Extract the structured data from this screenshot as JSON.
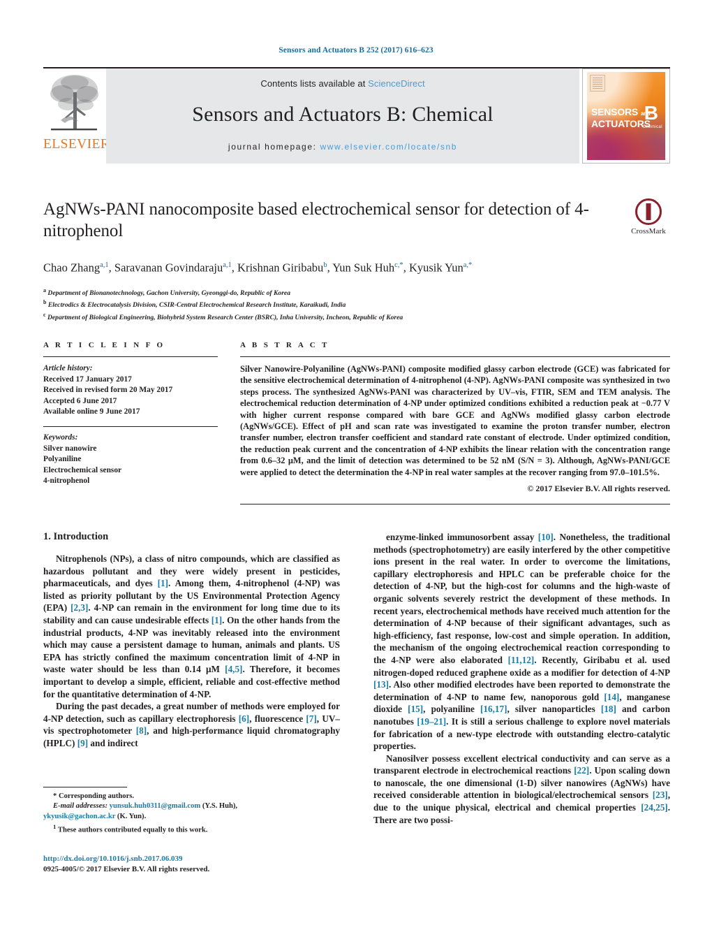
{
  "running_head": "Sensors and Actuators B 252 (2017) 616–623",
  "banner": {
    "publisher": "ELSEVIER",
    "contents_prefix": "Contents lists available at ",
    "contents_link": "ScienceDirect",
    "journal_title": "Sensors and Actuators B: Chemical",
    "homepage_label": "journal homepage:",
    "homepage_url": "www.elsevier.com/locate/snb",
    "cover": {
      "line1": "SENSORS",
      "line1_small": "and",
      "line2": "ACTUATORS",
      "letter": "B",
      "sub": "Chemical"
    }
  },
  "article": {
    "title": "AgNWs-PANI nanocomposite based electrochemical sensor for detection of 4-nitrophenol",
    "authors_html": "Chao Zhang<sup>a,1</sup>, Saravanan Govindaraju<sup>a,1</sup>, Krishnan Giribabu<sup>b</sup>, Yun Suk Huh<sup>c,*</sup>, Kyusik Yun<sup>a,*</sup>",
    "affiliations": [
      {
        "marker": "a",
        "text": "Department of Bionanotechnology, Gachon University, Gyeonggi-do, Republic of Korea"
      },
      {
        "marker": "b",
        "text": "Electrodics & Electrocatalysis Division, CSIR-Central Electrochemical Research Institute, Karaikudi, India"
      },
      {
        "marker": "c",
        "text": "Department of Biological Engineering, Biohybrid System Research Center (BSRC), Inha University, Incheon, Republic of Korea"
      }
    ],
    "crossmark_label": "CrossMark"
  },
  "article_info": {
    "heading": "A R T I C L E    I N F O",
    "history_label": "Article history:",
    "history": [
      "Received 17 January 2017",
      "Received in revised form 20 May 2017",
      "Accepted 6 June 2017",
      "Available online 9 June 2017"
    ],
    "keywords_label": "Keywords:",
    "keywords": [
      "Silver nanowire",
      "Polyaniline",
      "Electrochemical sensor",
      "4-nitrophenol"
    ]
  },
  "abstract": {
    "heading": "A B S T R A C T",
    "text": "Silver Nanowire-Polyaniline (AgNWs-PANI) composite modified glassy carbon electrode (GCE) was fabricated for the sensitive electrochemical determination of 4-nitrophenol (4-NP). AgNWs-PANI composite was synthesized in two steps process. The synthesized AgNWs-PANI was characterized by UV–vis, FTIR, SEM and TEM analysis. The electrochemical reduction determination of 4-NP under optimized conditions exhibited a reduction peak at −0.77 V with higher current response compared with bare GCE and AgNWs modified glassy carbon electrode (AgNWs/GCE). Effect of pH and scan rate was investigated to examine the proton transfer number, electron transfer number, electron transfer coefficient and standard rate constant of electrode. Under optimized condition, the reduction peak current and the concentration of 4-NP exhibits the linear relation with the concentration range from 0.6–32 μM, and the limit of detection was determined to be 52 nM (S/N = 3). Although, AgNWs-PANI/GCE were applied to detect the determination the 4-NP in real water samples at the recover ranging from 97.0–101.5%.",
    "copyright": "© 2017 Elsevier B.V. All rights reserved."
  },
  "introduction": {
    "heading": "1.  Introduction",
    "left_paragraphs_html": [
      "Nitrophenols (NPs), a class of nitro compounds, which are classified as hazardous pollutant and they were widely present in pesticides, pharmaceuticals, and dyes <span class=\"ref\">[1]</span>. Among them, 4-nitrophenol (4-NP) was listed as priority pollutant by the US Environmental Protection Agency (EPA) <span class=\"ref\">[2,3]</span>. 4-NP can remain in the environment for long time due to its stability and can cause undesirable effects <span class=\"ref\">[1]</span>. On the other hands from the industrial products, 4-NP was inevitably released into the environment which may cause a persistent damage to human, animals and plants. US EPA has strictly confined the maximum concentration limit of 4-NP in waste water should be less than 0.14 μM <span class=\"ref\">[4,5]</span>. Therefore, it becomes important to develop a simple, efficient, reliable and cost-effective method for the quantitative determination of 4-NP.",
      "During the past decades, a great number of methods were employed for 4-NP detection, such as capillary electrophoresis <span class=\"ref\">[6]</span>, fluorescence <span class=\"ref\">[7]</span>, UV–vis spectrophotometer <span class=\"ref\">[8]</span>, and high-performance liquid chromatography (HPLC) <span class=\"ref\">[9]</span> and indirect"
    ],
    "right_paragraphs_html": [
      "enzyme-linked immunosorbent assay <span class=\"ref\">[10]</span>. Nonetheless, the traditional methods (spectrophotometry) are easily interfered by the other competitive ions present in the real water. In order to overcome the limitations, capillary electrophoresis and HPLC can be preferable choice for the detection of 4-NP, but the high-cost for columns and the high-waste of organic solvents severely restrict the development of these methods. In recent years, electrochemical methods have received much attention for the determination of 4-NP because of their significant advantages, such as high-efficiency, fast response, low-cost and simple operation. In addition, the mechanism of the ongoing electrochemical reaction corresponding to the 4-NP were also elaborated <span class=\"ref\">[11,12]</span>. Recently, Giribabu et al. used nitrogen-doped reduced graphene oxide as a modifier for detection of 4-NP <span class=\"ref\">[13]</span>. Also other modified electrodes have been reported to demonstrate the determination of 4-NP to name few, nanoporous gold <span class=\"ref\">[14]</span>, manganese dioxide <span class=\"ref\">[15]</span>, polyaniline <span class=\"ref\">[16,17]</span>, silver nanoparticles <span class=\"ref\">[18]</span> and carbon nanotubes <span class=\"ref\">[19–21]</span>. It is still a serious challenge to explore novel materials for fabrication of a new-type electrode with outstanding electro-catalytic properties.",
      "Nanosilver possess excellent electrical conductivity and can serve as a transparent electrode in electrochemical reactions <span class=\"ref\">[22]</span>. Upon scaling down to nanoscale, the one dimensional (1-D) silver nanowires (AgNWs) have received considerable attention in biological/electrochemical sensors <span class=\"ref\">[23]</span>, due to the unique physical, electrical and chemical properties <span class=\"ref\">[24,25]</span>. There are two possi-"
    ]
  },
  "footnotes": {
    "corresponding": "*  Corresponding authors.",
    "email_label": "E-mail addresses:",
    "email1": "yunsuk.huh0311@gmail.com",
    "email1_owner": "(Y.S. Huh),",
    "email2": "ykyusik@gachon.ac.kr",
    "email2_owner": "(K. Yun).",
    "equal_contrib_marker": "1",
    "equal_contrib": "These authors contributed equally to this work."
  },
  "doi_block": {
    "doi": "http://dx.doi.org/10.1016/j.snb.2017.06.039",
    "issn_line": "0925-4005/© 2017 Elsevier B.V. All rights reserved."
  },
  "colors": {
    "link": "#1a7ba8",
    "header_blue": "#1a6b9c",
    "elsevier_orange": "#E87722",
    "banner_gray": "#e6e7e8"
  }
}
